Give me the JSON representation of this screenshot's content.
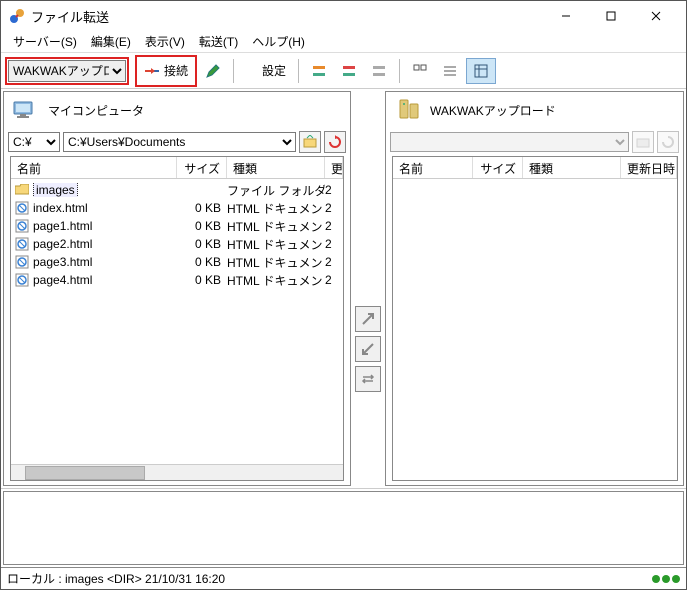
{
  "window": {
    "title": "ファイル転送"
  },
  "menu": {
    "server": "サーバー(S)",
    "edit": "編集(E)",
    "view": "表示(V)",
    "transfer": "転送(T)",
    "help": "ヘルプ(H)"
  },
  "toolbar": {
    "profile_selected": "WAKWAKアップロ",
    "connect_label": "接続",
    "settings_label": "設定"
  },
  "local": {
    "title": "マイコンピュータ",
    "drive_selected": "C:¥",
    "path_selected": "C:¥Users¥Documents",
    "columns": {
      "name": "名前",
      "size": "サイズ",
      "type": "種類",
      "upd": "更"
    },
    "files": [
      {
        "icon": "folder",
        "name": "images",
        "size": "",
        "type": "ファイル フォルダー",
        "date": "2",
        "selected": true
      },
      {
        "icon": "html",
        "name": "index.html",
        "size": "0 KB",
        "type": "HTML ドキュメント",
        "date": "2"
      },
      {
        "icon": "html",
        "name": "page1.html",
        "size": "0 KB",
        "type": "HTML ドキュメント",
        "date": "2"
      },
      {
        "icon": "html",
        "name": "page2.html",
        "size": "0 KB",
        "type": "HTML ドキュメント",
        "date": "2"
      },
      {
        "icon": "html",
        "name": "page3.html",
        "size": "0 KB",
        "type": "HTML ドキュメント",
        "date": "2"
      },
      {
        "icon": "html",
        "name": "page4.html",
        "size": "0 KB",
        "type": "HTML ドキュメント",
        "date": "2"
      }
    ]
  },
  "remote": {
    "title": "WAKWAKアップロード",
    "path_selected": "",
    "columns": {
      "name": "名前",
      "size": "サイズ",
      "type": "種類",
      "updated": "更新日時"
    }
  },
  "status": {
    "text": "ローカル : images <DIR> 21/10/31 16:20"
  }
}
